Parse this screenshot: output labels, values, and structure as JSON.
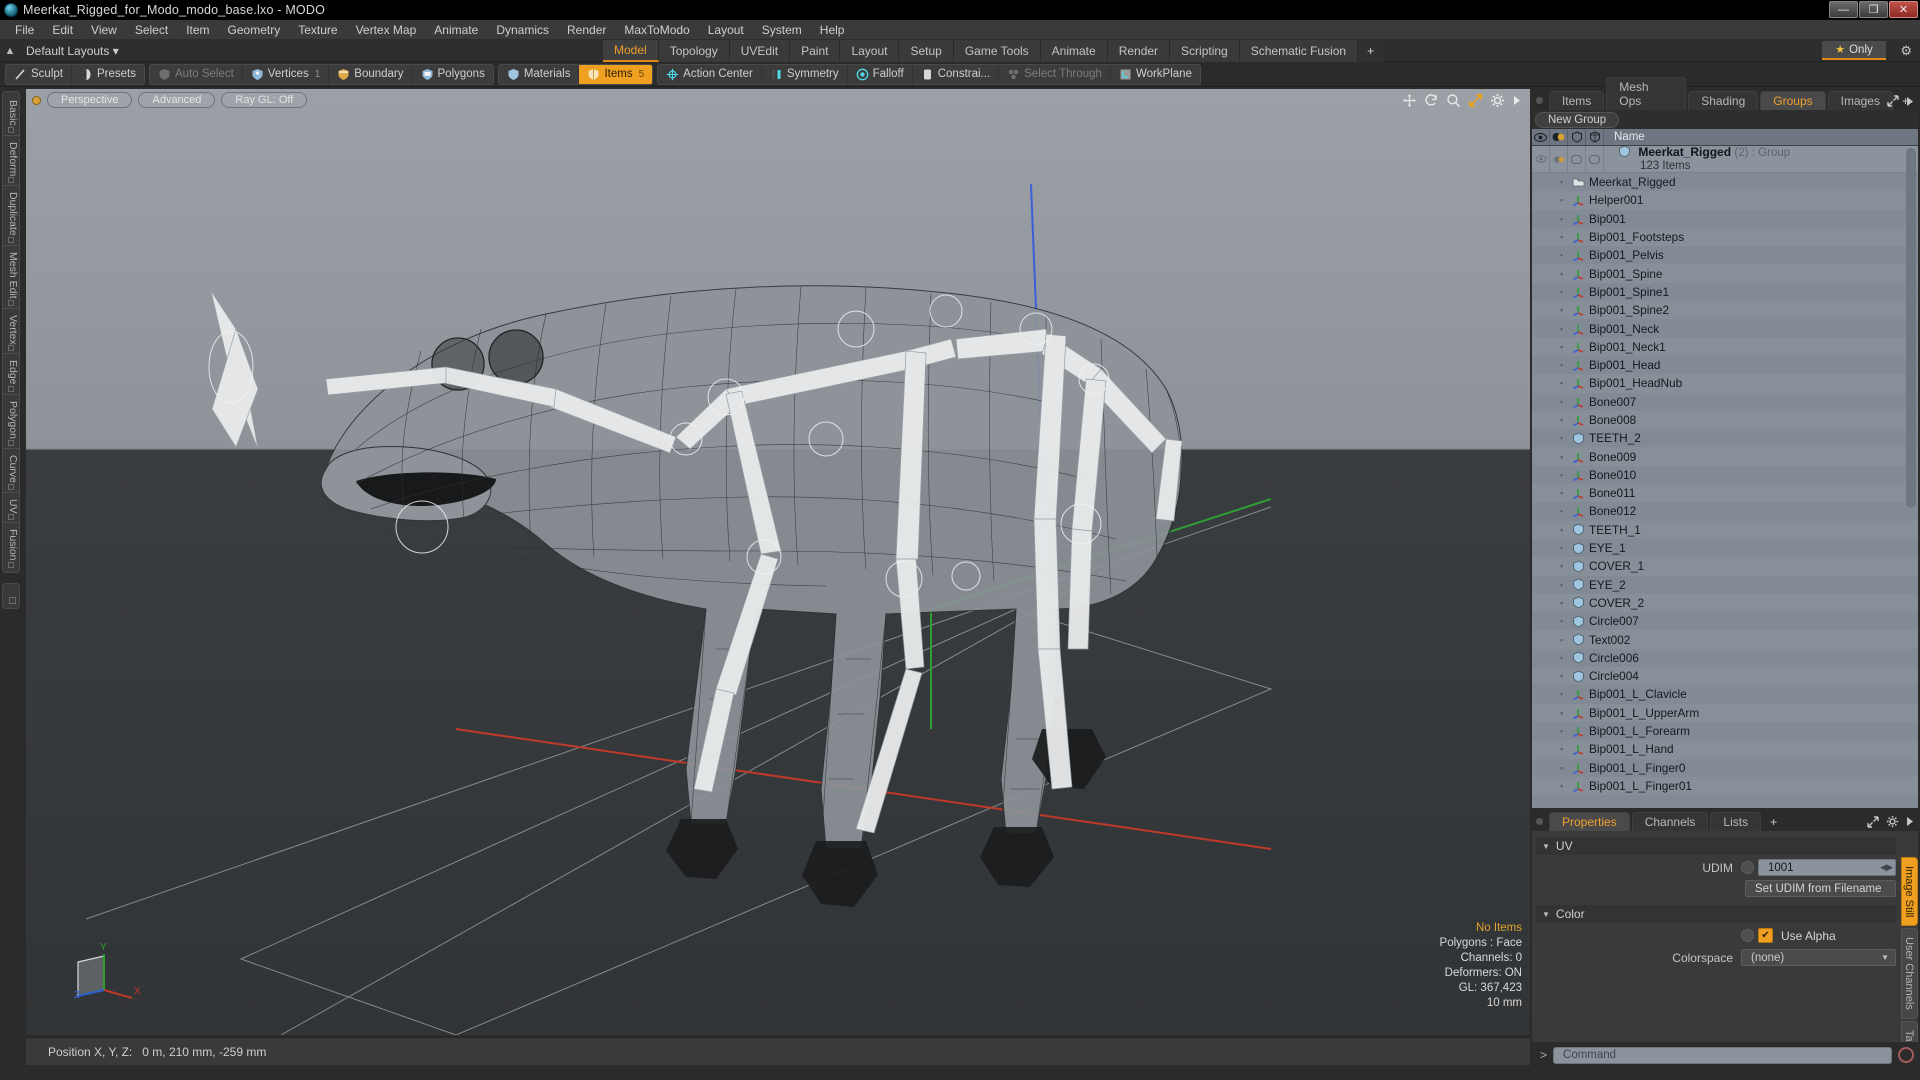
{
  "window": {
    "title": "Meerkat_Rigged_for_Modo_modo_base.lxo - MODO",
    "app_icon": "modo-logo-icon",
    "controls": [
      {
        "name": "minimize",
        "glyph": "—"
      },
      {
        "name": "restore",
        "glyph": "❐"
      },
      {
        "name": "close",
        "glyph": "✕"
      }
    ]
  },
  "menubar": {
    "items": [
      "File",
      "Edit",
      "View",
      "Select",
      "Item",
      "Geometry",
      "Texture",
      "Vertex Map",
      "Animate",
      "Dynamics",
      "Render",
      "MaxToModo",
      "Layout",
      "System",
      "Help"
    ]
  },
  "layoutbar": {
    "home_icon": "home-icon",
    "layout_label": "Default Layouts",
    "layout_caret": "▾",
    "mode_tabs": [
      {
        "label": "Model",
        "active": true
      },
      {
        "label": "Topology",
        "active": false
      },
      {
        "label": "UVEdit",
        "active": false
      },
      {
        "label": "Paint",
        "active": false
      },
      {
        "label": "Layout",
        "active": false
      },
      {
        "label": "Setup",
        "active": false
      },
      {
        "label": "Game Tools",
        "active": false
      },
      {
        "label": "Animate",
        "active": false
      },
      {
        "label": "Render",
        "active": false
      },
      {
        "label": "Scripting",
        "active": false
      },
      {
        "label": "Schematic Fusion",
        "active": false
      }
    ],
    "add_tab_label": "+",
    "only_label": "Only",
    "only_star": "★",
    "gear_icon": "gear-icon",
    "accent_color": "#e08c14"
  },
  "toolbar": {
    "group1": [
      {
        "label": "Sculpt",
        "icon": "sculpt-icon",
        "state": "normal"
      },
      {
        "label": "Presets",
        "icon": "presets-icon",
        "state": "normal"
      }
    ],
    "group2": [
      {
        "label": "Auto Select",
        "icon": "shield-grey-icon",
        "state": "dim"
      },
      {
        "label": "Vertices",
        "icon": "vertices-icon",
        "state": "normal",
        "count": "1"
      },
      {
        "label": "Boundary",
        "icon": "boundary-icon",
        "state": "normal"
      },
      {
        "label": "Polygons",
        "icon": "polygons-icon",
        "state": "normal"
      }
    ],
    "group3": [
      {
        "label": "Materials",
        "icon": "materials-icon",
        "state": "normal"
      },
      {
        "label": "Items",
        "icon": "items-icon",
        "state": "on",
        "count": "5"
      }
    ],
    "group4": [
      {
        "label": "Action Center",
        "icon": "action-center-icon",
        "state": "normal"
      },
      {
        "label": "Symmetry",
        "icon": "symmetry-icon",
        "state": "normal"
      },
      {
        "label": "Falloff",
        "icon": "falloff-icon",
        "state": "normal"
      },
      {
        "label": "Constrai...",
        "icon": "constraint-icon",
        "state": "normal"
      },
      {
        "label": "Select Through",
        "icon": "select-through-icon",
        "state": "dim"
      },
      {
        "label": "WorkPlane",
        "icon": "workplane-icon",
        "state": "normal"
      }
    ]
  },
  "left_tabs": {
    "items": [
      "Basic",
      "Deform",
      "Duplicate",
      "Mesh Edit",
      "Vertex",
      "Edge",
      "Polygon",
      "Curve",
      "UV",
      "Fusion"
    ]
  },
  "viewport": {
    "dot_icon": "viewport-state-dot",
    "pills": [
      "Perspective",
      "Advanced",
      "Ray GL: Off"
    ],
    "tool_icons": [
      "move-icon",
      "rotate-icon",
      "zoom-icon",
      "fit-icon",
      "gear-icon",
      "play-icon"
    ],
    "info": {
      "selection": "No Items",
      "lines": [
        "Polygons : Face",
        "Channels: 0",
        "Deformers: ON",
        "GL: 367,423",
        "10 mm"
      ]
    },
    "axis_gizmo": {
      "x": "X",
      "y": "Y",
      "z": "Z"
    }
  },
  "statusbar": {
    "label": "Position X, Y, Z:",
    "value": "0 m, 210 mm, -259 mm"
  },
  "right_panel": {
    "tabs": [
      {
        "label": "Items",
        "active": false
      },
      {
        "label": "Mesh Ops",
        "active": false
      },
      {
        "label": "Shading",
        "active": false
      },
      {
        "label": "Groups",
        "active": true
      },
      {
        "label": "Images",
        "active": false
      }
    ],
    "add_tab_label": "+",
    "expand_icon": "expand-icon",
    "menu_icon": "play-icon",
    "group_button": "New Group",
    "list_header": {
      "columns": [
        "eye-icon",
        "render-icon",
        "shade-icon",
        "wire-icon"
      ],
      "name": "Name"
    },
    "group_row": {
      "name": "Meerkat_Rigged",
      "count": "(2)",
      "type": ": Group",
      "subtitle": "123 Items",
      "icon": "mesh-icon"
    },
    "items": [
      {
        "label": "Meerkat_Rigged",
        "icon": "group-folder-icon"
      },
      {
        "label": "Helper001",
        "icon": "locator-icon"
      },
      {
        "label": "Bip001",
        "icon": "locator-icon"
      },
      {
        "label": "Bip001_Footsteps",
        "icon": "locator-icon"
      },
      {
        "label": "Bip001_Pelvis",
        "icon": "locator-icon"
      },
      {
        "label": "Bip001_Spine",
        "icon": "locator-icon"
      },
      {
        "label": "Bip001_Spine1",
        "icon": "locator-icon"
      },
      {
        "label": "Bip001_Spine2",
        "icon": "locator-icon"
      },
      {
        "label": "Bip001_Neck",
        "icon": "locator-icon"
      },
      {
        "label": "Bip001_Neck1",
        "icon": "locator-icon"
      },
      {
        "label": "Bip001_Head",
        "icon": "locator-icon"
      },
      {
        "label": "Bip001_HeadNub",
        "icon": "locator-icon"
      },
      {
        "label": "Bone007",
        "icon": "locator-icon"
      },
      {
        "label": "Bone008",
        "icon": "locator-icon"
      },
      {
        "label": "TEETH_2",
        "icon": "mesh-icon"
      },
      {
        "label": "Bone009",
        "icon": "locator-icon"
      },
      {
        "label": "Bone010",
        "icon": "locator-icon"
      },
      {
        "label": "Bone011",
        "icon": "locator-icon"
      },
      {
        "label": "Bone012",
        "icon": "locator-icon"
      },
      {
        "label": "TEETH_1",
        "icon": "mesh-icon"
      },
      {
        "label": "EYE_1",
        "icon": "mesh-icon"
      },
      {
        "label": "COVER_1",
        "icon": "mesh-icon"
      },
      {
        "label": "EYE_2",
        "icon": "mesh-icon"
      },
      {
        "label": "COVER_2",
        "icon": "mesh-icon"
      },
      {
        "label": "Circle007",
        "icon": "mesh-icon"
      },
      {
        "label": "Text002",
        "icon": "mesh-icon"
      },
      {
        "label": "Circle006",
        "icon": "mesh-icon"
      },
      {
        "label": "Circle004",
        "icon": "mesh-icon"
      },
      {
        "label": "Bip001_L_Clavicle",
        "icon": "locator-icon"
      },
      {
        "label": "Bip001_L_UpperArm",
        "icon": "locator-icon"
      },
      {
        "label": "Bip001_L_Forearm",
        "icon": "locator-icon"
      },
      {
        "label": "Bip001_L_Hand",
        "icon": "locator-icon"
      },
      {
        "label": "Bip001_L_Finger0",
        "icon": "locator-icon"
      },
      {
        "label": "Bip001_L_Finger01",
        "icon": "locator-icon"
      }
    ]
  },
  "properties": {
    "tabs": [
      {
        "label": "Properties",
        "active": true
      },
      {
        "label": "Channels",
        "active": false
      },
      {
        "label": "Lists",
        "active": false
      }
    ],
    "add_tab_label": "+",
    "expand_icon": "expand-icon",
    "gear_icon": "gear-icon",
    "menu_icon": "play-icon",
    "sections": [
      {
        "title": "UV",
        "triangle": "▼",
        "rows": [
          {
            "type": "field",
            "label": "UDIM",
            "value": "1001",
            "spinner": "◀▶"
          },
          {
            "type": "button",
            "label": "Set UDIM from Filename"
          }
        ]
      },
      {
        "title": "Color",
        "triangle": "▼",
        "rows": [
          {
            "type": "checkbox",
            "label": "Use Alpha",
            "checked": true,
            "check_glyph": "✔"
          },
          {
            "type": "select",
            "label": "Colorspace",
            "value": "(none)",
            "caret": "▼"
          }
        ]
      }
    ],
    "side_tabs": [
      {
        "label": "Image Still",
        "active": true
      },
      {
        "label": "User Channels",
        "active": false
      },
      {
        "label": "Tags",
        "active": false
      }
    ]
  },
  "command_bar": {
    "prompt": ">",
    "placeholder": "Command",
    "record_icon": "record-icon"
  }
}
